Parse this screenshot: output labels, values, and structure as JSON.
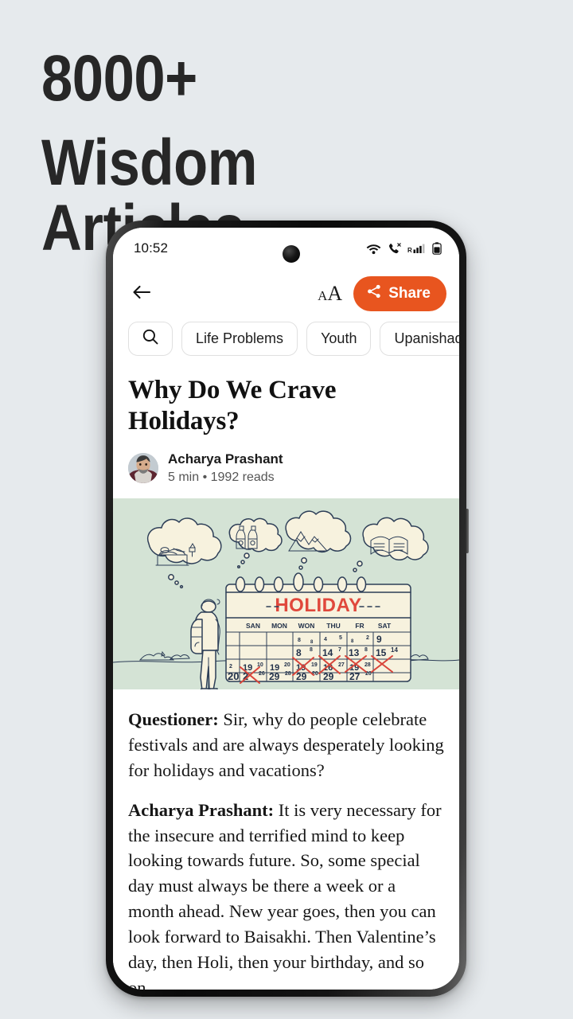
{
  "promo": {
    "line1": "8000+",
    "line2": "Wisdom Articles"
  },
  "colors": {
    "page_background": "#e6eaed",
    "accent_orange": "#e8551f",
    "illustration_background": "#d4e3d5",
    "calendar_paper": "#f6f0dc",
    "illustration_ink": "#2d3e57",
    "holiday_red": "#e0483c"
  },
  "phone": {
    "statusbar": {
      "time": "10:52",
      "icons": [
        "wifi-icon",
        "call-icon",
        "signal-icon",
        "battery-icon"
      ],
      "signal_label": "R"
    },
    "toolbar": {
      "back_icon": "arrow-left-icon",
      "font_size_small": "A",
      "font_size_large": "A",
      "share_label": "Share",
      "share_icon": "share-icon"
    },
    "chips": {
      "search_icon": "search-icon",
      "items": [
        {
          "label": "Life Problems"
        },
        {
          "label": "Youth"
        },
        {
          "label": "Upanishads"
        }
      ]
    },
    "article": {
      "title": "Why Do We Crave Holidays?",
      "author": "Acharya Prashant",
      "meta": "5 min • 1992 reads",
      "avatar_name": "author-avatar",
      "illustration": {
        "name": "holiday-calendar-illustration",
        "calendar_title": "HOLIDAY",
        "day_headers": [
          "SAN",
          "MON",
          "WON",
          "THU",
          "FR",
          "SAT"
        ],
        "rows": [
          [
            "",
            "",
            "8",
            "4",
            "8",
            "9"
          ],
          [
            "",
            "",
            "8",
            "14",
            "13",
            "15"
          ],
          [
            "2",
            "19",
            "19",
            "19",
            "16",
            "19"
          ],
          [
            "20",
            "2",
            "29",
            "29",
            "29",
            "27"
          ]
        ],
        "thought_bubbles": [
          "sleeping-in-bed",
          "drink-bottles",
          "mountains",
          "open-book"
        ],
        "figure": "person-with-backpack"
      },
      "paragraphs": [
        {
          "speaker": "Questioner:",
          "text": " Sir, why do people celebrate festivals and are always desperately looking for holidays and vacations?"
        },
        {
          "speaker": "Acharya Prashant:",
          "text": " It is very necessary for the insecure and terrified mind to keep looking towards future. So, some special day must always be there a week or a month ahead. New year goes, then you can look forward to Baisakhi. Then Valentine’s day, then Holi, then your birthday, and so on."
        }
      ]
    }
  }
}
